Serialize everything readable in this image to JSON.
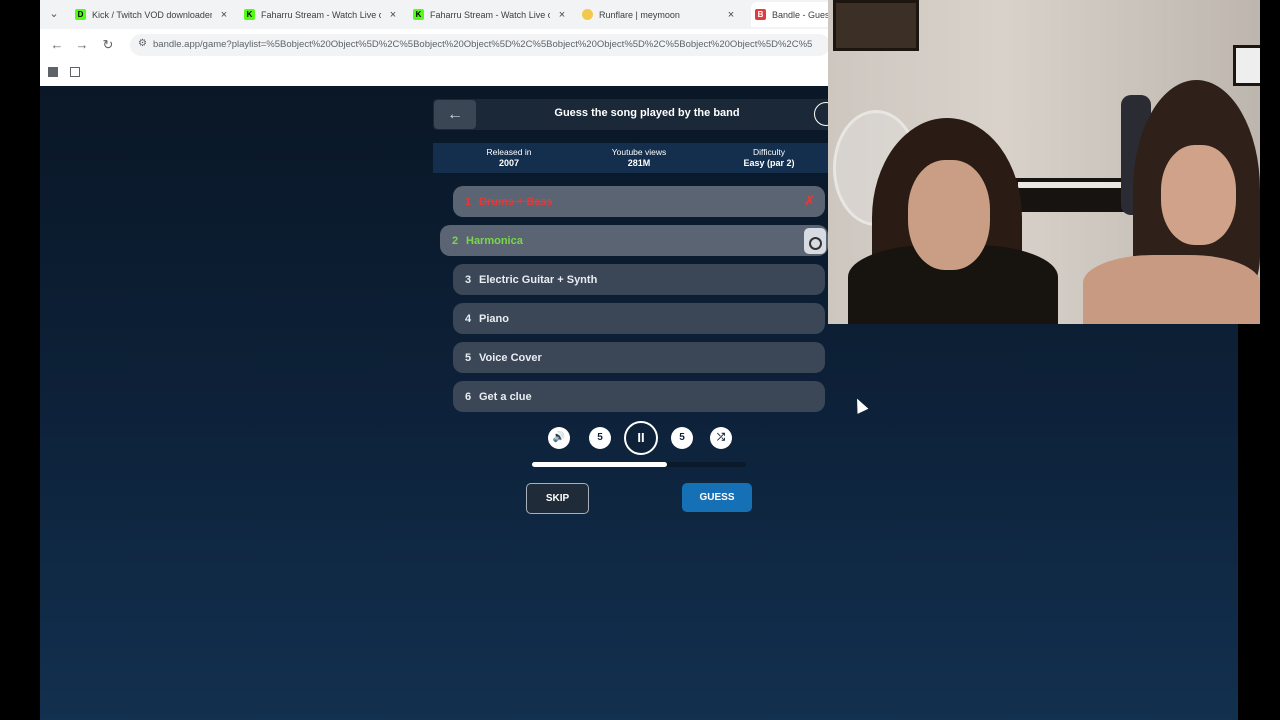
{
  "browser": {
    "tabs": [
      {
        "label": "Kick / Twitch VOD downloader",
        "fav_color": "#53fc18",
        "fav_letter": "D"
      },
      {
        "label": "Faharru Stream - Watch Live on",
        "fav_color": "#53fc18",
        "fav_letter": "K"
      },
      {
        "label": "Faharru Stream - Watch Live on",
        "fav_color": "#53fc18",
        "fav_letter": "K"
      },
      {
        "label": "Runflare | meymoon",
        "fav_color": "#f2c94c",
        "fav_letter": ""
      },
      {
        "label": "Bandle - Guess",
        "fav_color": "#e23b3b",
        "fav_letter": "B"
      }
    ],
    "tab_close": "×",
    "url": "bandle.app/game?playlist=%5Bobject%20Object%5D%2C%5Bobject%20Object%5D%2C%5Bobject%20Object%5D%2C%5Bobject%20Object%5D%2C%5",
    "nav": {
      "back": "←",
      "forward": "→",
      "reload": "↻"
    }
  },
  "game": {
    "title": "Guess the song played by the band",
    "back_icon": "←",
    "stats": [
      {
        "label": "Released in",
        "value": "2007"
      },
      {
        "label": "Youtube views",
        "value": "281M"
      },
      {
        "label": "Difficulty",
        "value": "Easy (par 2)"
      }
    ],
    "rows": [
      {
        "num": "1",
        "label": "Drums + Bass",
        "state": "wrong"
      },
      {
        "num": "2",
        "label": "Harmonica",
        "state": "active"
      },
      {
        "num": "3",
        "label": "Electric Guitar + Synth",
        "state": "pending"
      },
      {
        "num": "4",
        "label": "Piano",
        "state": "pending"
      },
      {
        "num": "5",
        "label": "Voice Cover",
        "state": "pending"
      },
      {
        "num": "6",
        "label": "Get a clue",
        "state": "pending"
      }
    ],
    "wrong_mark": "✗",
    "controls": {
      "volume": "🔊",
      "rewind": "5",
      "pause": "II",
      "forward": "5",
      "shuffle": "⤮"
    },
    "progress": 0.63,
    "skip_label": "SKIP",
    "guess_label": "GUESS"
  },
  "colors": {
    "accent": "#1570b5",
    "correct": "#78d84a",
    "wrong": "#e03a3a"
  }
}
